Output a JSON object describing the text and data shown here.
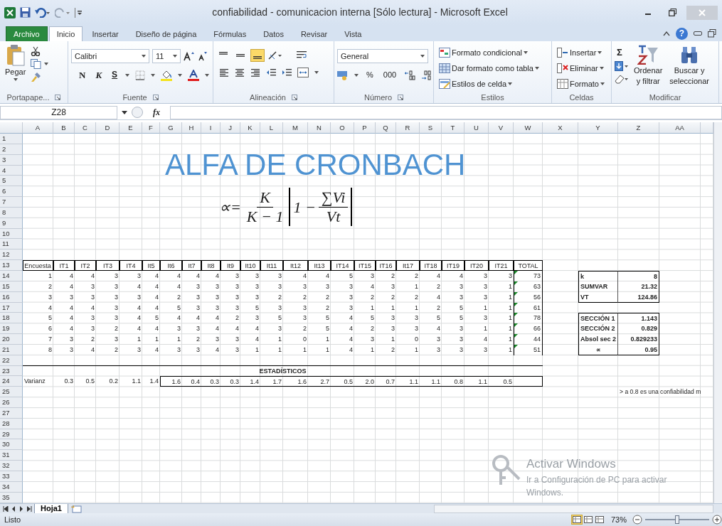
{
  "window": {
    "title": "confiabilidad - comunicacion interna  [Sólo lectura] - Microsoft Excel"
  },
  "ribbon_tabs": [
    {
      "label": "Archivo",
      "kind": "file",
      "selected": false
    },
    {
      "label": "Inicio",
      "kind": "tab",
      "selected": true
    },
    {
      "label": "Insertar",
      "kind": "tab",
      "selected": false
    },
    {
      "label": "Diseño de página",
      "kind": "tab",
      "selected": false
    },
    {
      "label": "Fórmulas",
      "kind": "tab",
      "selected": false
    },
    {
      "label": "Datos",
      "kind": "tab",
      "selected": false
    },
    {
      "label": "Revisar",
      "kind": "tab",
      "selected": false
    },
    {
      "label": "Vista",
      "kind": "tab",
      "selected": false
    }
  ],
  "help": "?",
  "clipboard": {
    "paste": "Pegar",
    "group": "Portapape..."
  },
  "font": {
    "name": "Calibri",
    "size": "11",
    "bold": "N",
    "italic": "K",
    "underline": "S",
    "group": "Fuente"
  },
  "alignment": {
    "vertical": [
      {
        "selected": false
      },
      {
        "selected": false
      },
      {
        "selected": true
      }
    ],
    "group": "Alineación"
  },
  "number": {
    "format": "General",
    "percent": "%",
    "thousands": "000",
    "group": "Número"
  },
  "styles": {
    "items": [
      "Formato condicional",
      "Dar formato como tabla",
      "Estilos de celda"
    ],
    "group": "Estilos"
  },
  "cells": {
    "items": [
      "Insertar",
      "Eliminar",
      "Formato"
    ],
    "group": "Celdas"
  },
  "editing": {
    "sum": "Σ",
    "sort": [
      "Ordenar",
      "y filtrar"
    ],
    "find": [
      "Buscar y",
      "seleccionar"
    ],
    "group": "Modificar"
  },
  "formula_bar": {
    "name_box": "Z28",
    "fx": "fx"
  },
  "columns": [
    "A",
    "B",
    "C",
    "D",
    "E",
    "F",
    "G",
    "H",
    "I",
    "J",
    "K",
    "L",
    "M",
    "N",
    "O",
    "P",
    "Q",
    "R",
    "S",
    "T",
    "U",
    "V",
    "W",
    "X",
    "Y",
    "Z",
    "AA"
  ],
  "row_numbers": [
    "1",
    "2",
    "3",
    "4",
    "5",
    "6",
    "7",
    "8",
    "9",
    "10",
    "11",
    "12",
    "13",
    "14",
    "15",
    "16",
    "17",
    "18",
    "19",
    "20",
    "21",
    "22",
    "23",
    "24",
    "25",
    "26",
    "27",
    "28",
    "29",
    "30",
    "31",
    "32",
    "33",
    "34",
    "35"
  ],
  "heading": "ALFA DE CRONBACH",
  "formula": {
    "symbol": "∝=",
    "num1": "K",
    "den1": "K − 1",
    "one": "1 −",
    "num2": "∑Vi",
    "den2": "Vt"
  },
  "survey": {
    "headers": [
      "Encuesta",
      "IT1",
      "IT2",
      "IT3",
      "IT4",
      "It5",
      "It6",
      "It7",
      "It8",
      "It9",
      "It10",
      "It11",
      "It12",
      "It13",
      "IT14",
      "IT15",
      "IT16",
      "It17",
      "IT18",
      "IT19",
      "IT20",
      "IT21",
      "TOTAL"
    ],
    "rows": [
      {
        "cells": [
          "1",
          "4",
          "4",
          "3",
          "3",
          "4",
          "4",
          "4",
          "4",
          "3",
          "3",
          "3",
          "4",
          "4",
          "5",
          "3",
          "2",
          "2",
          "4",
          "4",
          "3",
          "3",
          "73"
        ],
        "flagged": true
      },
      {
        "cells": [
          "2",
          "4",
          "3",
          "3",
          "4",
          "4",
          "4",
          "3",
          "3",
          "3",
          "3",
          "3",
          "3",
          "3",
          "3",
          "4",
          "3",
          "1",
          "2",
          "3",
          "3",
          "1",
          "63"
        ],
        "flagged": true
      },
      {
        "cells": [
          "3",
          "3",
          "3",
          "3",
          "3",
          "4",
          "2",
          "3",
          "3",
          "3",
          "3",
          "2",
          "2",
          "2",
          "3",
          "2",
          "2",
          "2",
          "4",
          "3",
          "3",
          "1",
          "56"
        ],
        "flagged": true
      },
      {
        "cells": [
          "4",
          "4",
          "4",
          "3",
          "4",
          "4",
          "5",
          "3",
          "3",
          "3",
          "5",
          "3",
          "3",
          "2",
          "3",
          "1",
          "1",
          "1",
          "2",
          "5",
          "1",
          "1",
          "61"
        ],
        "flagged": true
      },
      {
        "cells": [
          "5",
          "4",
          "3",
          "3",
          "4",
          "5",
          "4",
          "4",
          "4",
          "2",
          "3",
          "5",
          "3",
          "5",
          "4",
          "5",
          "3",
          "3",
          "5",
          "5",
          "3",
          "1",
          "78"
        ],
        "flagged": true
      },
      {
        "cells": [
          "6",
          "4",
          "3",
          "2",
          "4",
          "4",
          "3",
          "3",
          "4",
          "4",
          "4",
          "3",
          "2",
          "5",
          "4",
          "2",
          "3",
          "3",
          "4",
          "3",
          "1",
          "1",
          "66"
        ],
        "flagged": true
      },
      {
        "cells": [
          "7",
          "3",
          "2",
          "3",
          "1",
          "1",
          "1",
          "2",
          "3",
          "3",
          "4",
          "1",
          "0",
          "1",
          "4",
          "3",
          "1",
          "0",
          "3",
          "3",
          "4",
          "1",
          "44"
        ],
        "flagged": true
      },
      {
        "cells": [
          "8",
          "3",
          "4",
          "2",
          "3",
          "4",
          "3",
          "3",
          "4",
          "3",
          "1",
          "1",
          "1",
          "1",
          "4",
          "1",
          "2",
          "1",
          "3",
          "3",
          "3",
          "1",
          "51"
        ],
        "flagged": true
      }
    ]
  },
  "statistics": {
    "title": "ESTADÍSTICOS",
    "label": "Varianz",
    "values": [
      "0.3",
      "0.5",
      "0.2",
      "1.1",
      "1.4",
      "1.6",
      "0.4",
      "0.3",
      "0.3",
      "1.4",
      "1.7",
      "1.6",
      "2.7",
      "0.5",
      "2.0",
      "0.7",
      "1.1",
      "1.1",
      "0.8",
      "1.1",
      "0.5"
    ]
  },
  "summary": [
    [
      {
        "label": "k",
        "value": "8"
      },
      {
        "label": "SUMVAR",
        "value": "21.32"
      },
      {
        "label": "VT",
        "value": "124.86"
      }
    ],
    [
      {
        "label": "SECCIÓN 1",
        "value": "1.143"
      },
      {
        "label": "SECCIÓN 2",
        "value": "0.829"
      },
      {
        "label": "Absol sec 2",
        "value": "0.829233"
      },
      {
        "label": "∝",
        "value": "0.95"
      }
    ]
  ],
  "note": "> a 0.8 es una confiabilidad m",
  "sheet_tabs": [
    {
      "label": "Hoja1",
      "selected": true
    }
  ],
  "activation": {
    "title": "Activar Windows",
    "line": "Ir a Configuración de PC para activar",
    "line2": "Windows."
  },
  "status_bar": {
    "text": "Listo",
    "views": [
      {
        "selected": true
      },
      {
        "selected": false
      },
      {
        "selected": false
      }
    ],
    "zoom": "73%",
    "zoom_slider": {
      "level": 0.5
    }
  }
}
